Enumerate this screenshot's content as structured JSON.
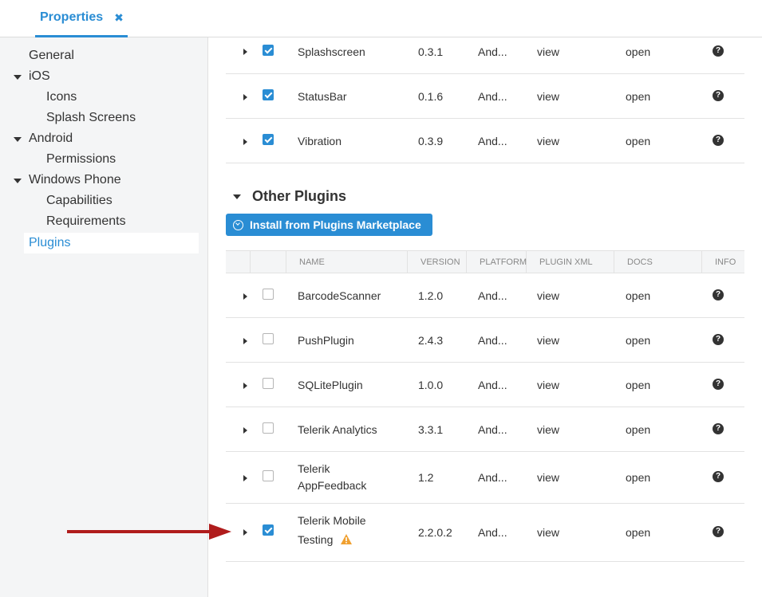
{
  "tab": {
    "label": "Properties",
    "close": "✖"
  },
  "sidebar": {
    "items": [
      {
        "label": "General"
      },
      {
        "label": "iOS"
      },
      {
        "label": "Icons"
      },
      {
        "label": "Splash Screens"
      },
      {
        "label": "Android"
      },
      {
        "label": "Permissions"
      },
      {
        "label": "Windows Phone"
      },
      {
        "label": "Capabilities"
      },
      {
        "label": "Requirements"
      },
      {
        "label": "Plugins"
      }
    ]
  },
  "core_rows": [
    {
      "name": "Splashscreen",
      "version": "0.3.1",
      "platform": "And...",
      "xml": "view",
      "docs": "open",
      "checked": true
    },
    {
      "name": "StatusBar",
      "version": "0.1.6",
      "platform": "And...",
      "xml": "view",
      "docs": "open",
      "checked": true
    },
    {
      "name": "Vibration",
      "version": "0.3.9",
      "platform": "And...",
      "xml": "view",
      "docs": "open",
      "checked": true
    }
  ],
  "other_plugins": {
    "title": "Other Plugins",
    "install_label": "Install from Plugins Marketplace",
    "columns": [
      "NAME",
      "VERSION",
      "PLATFORM",
      "PLUGIN XML",
      "DOCS",
      "INFO"
    ],
    "rows": [
      {
        "name": "BarcodeScanner",
        "version": "1.2.0",
        "platform": "And...",
        "xml": "view",
        "docs": "open",
        "checked": false
      },
      {
        "name": "PushPlugin",
        "version": "2.4.3",
        "platform": "And...",
        "xml": "view",
        "docs": "open",
        "checked": false
      },
      {
        "name": "SQLitePlugin",
        "version": "1.0.0",
        "platform": "And...",
        "xml": "view",
        "docs": "open",
        "checked": false
      },
      {
        "name": "Telerik Analytics",
        "version": "3.3.1",
        "platform": "And...",
        "xml": "view",
        "docs": "open",
        "checked": false
      },
      {
        "name_line1": "Telerik",
        "name_line2": "AppFeedback",
        "version": "1.2",
        "platform": "And...",
        "xml": "view",
        "docs": "open",
        "checked": false
      },
      {
        "name_line1": "Telerik Mobile",
        "name_line2": "Testing",
        "version": "2.2.0.2",
        "platform": "And...",
        "xml": "view",
        "docs": "open",
        "checked": true,
        "warning": true
      }
    ]
  },
  "colors": {
    "accent": "#2a8dd4",
    "arrow": "#b01c1c",
    "warning": "#f0a030"
  }
}
